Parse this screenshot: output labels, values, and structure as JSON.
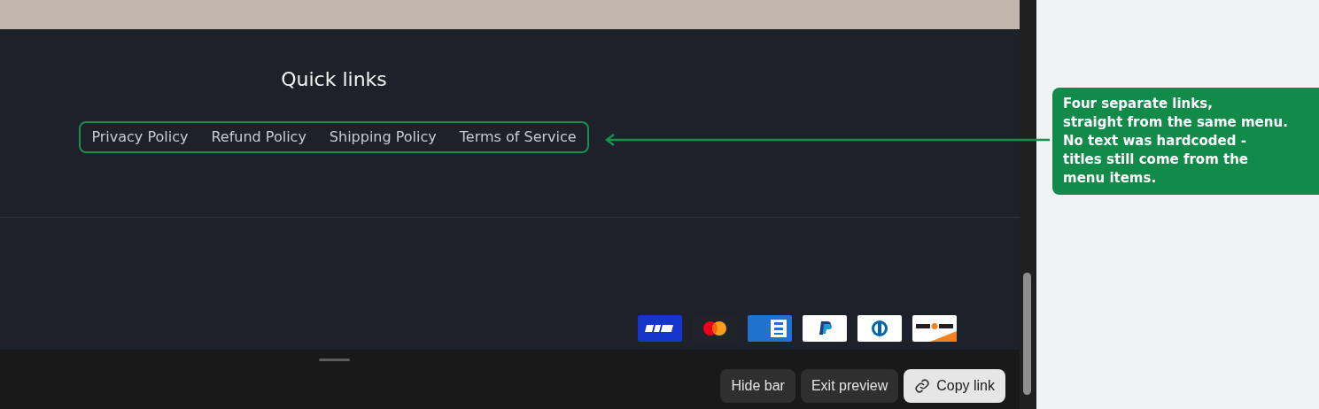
{
  "footer": {
    "heading": "Quick links",
    "links": [
      {
        "label": "Privacy Policy"
      },
      {
        "label": "Refund Policy"
      },
      {
        "label": "Shipping Policy"
      },
      {
        "label": "Terms of Service"
      }
    ],
    "payment_icons": [
      {
        "kind": "visa"
      },
      {
        "kind": "mastercard"
      },
      {
        "kind": "amex"
      },
      {
        "kind": "paypal"
      },
      {
        "kind": "diners"
      },
      {
        "kind": "discover"
      }
    ]
  },
  "preview_bar": {
    "buttons": [
      {
        "label": "Hide bar",
        "kind": "dark"
      },
      {
        "label": "Exit preview",
        "kind": "dark"
      },
      {
        "label": "Copy link",
        "kind": "light"
      }
    ]
  },
  "annotation": {
    "text": "Four separate links,\nstraight from the same menu.\nNo text was hardcoded -\ntitles still come from the\nmenu items."
  }
}
